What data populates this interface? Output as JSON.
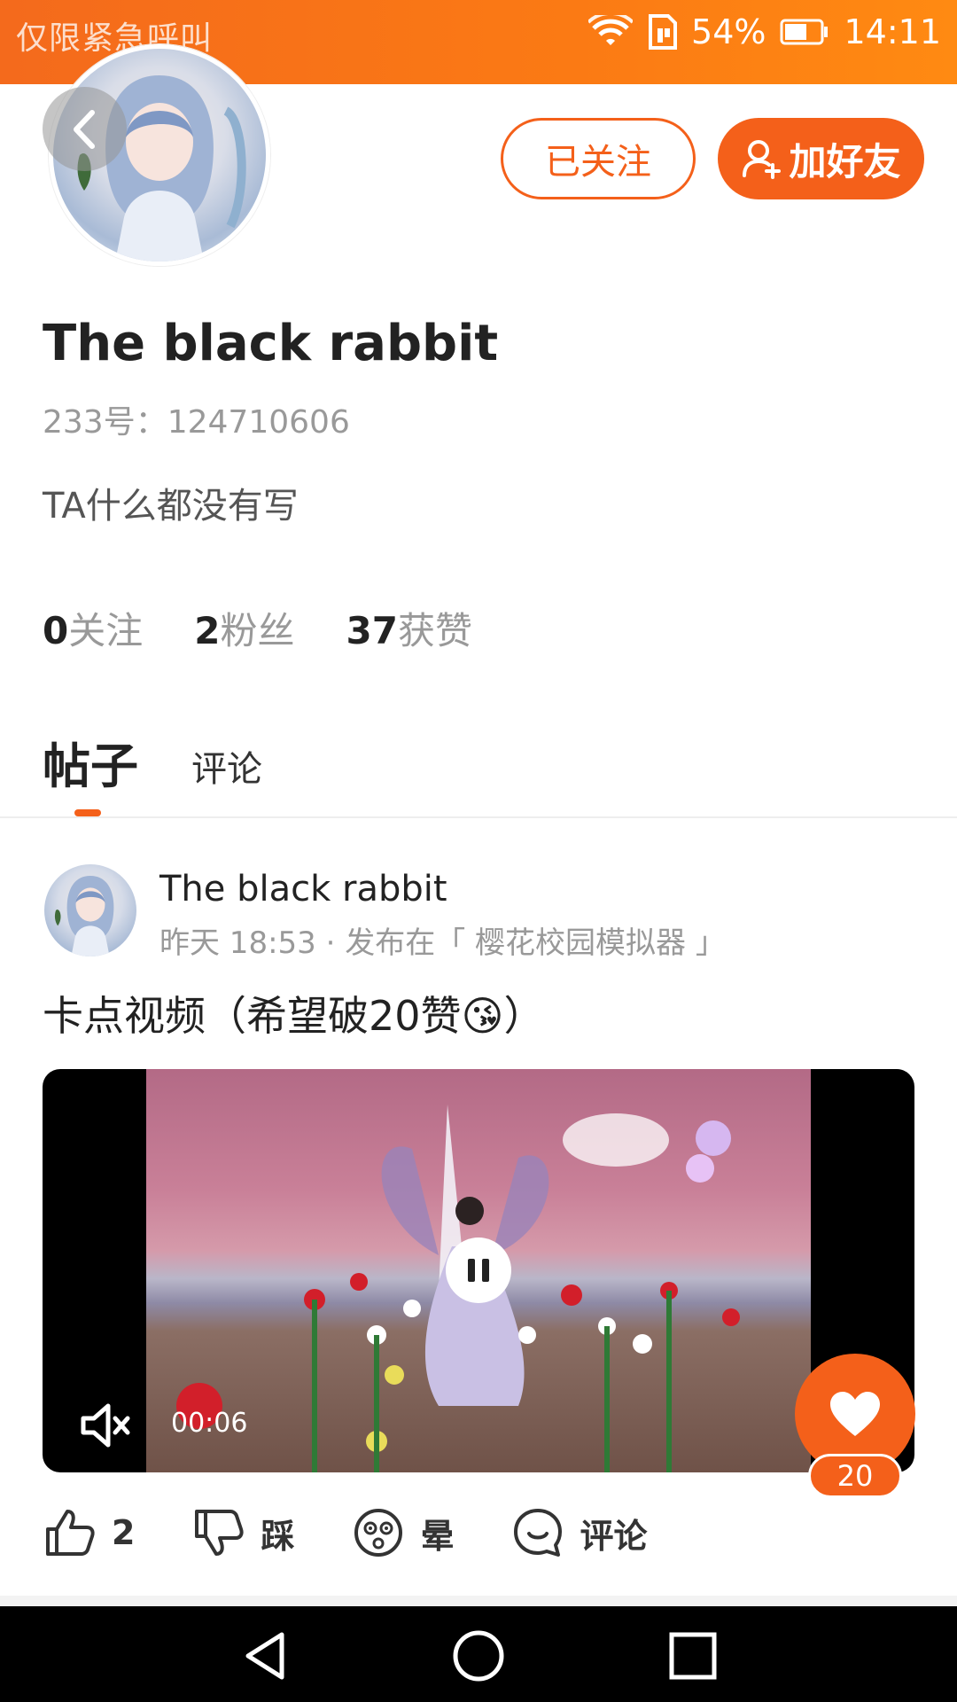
{
  "status_bar": {
    "carrier_text": "仅限紧急呼叫",
    "battery": "54%",
    "time": "14:11"
  },
  "profile": {
    "followed_label": "已关注",
    "add_friend_label": "加好友",
    "name": "The black rabbit",
    "id_label": "233号：",
    "id_value": "124710606",
    "bio": "TA什么都没有写",
    "stats": [
      {
        "num": "0",
        "label": "关注"
      },
      {
        "num": "2",
        "label": "粉丝"
      },
      {
        "num": "37",
        "label": "获赞"
      }
    ]
  },
  "tabs": {
    "posts": "帖子",
    "comments": "评论"
  },
  "post": {
    "author": "The black rabbit",
    "time": "昨天 18:53",
    "separator": " · ",
    "published_in": "发布在「 樱花校园模拟器 」",
    "title_text": "卡点视频（希望破20赞",
    "title_emoji": "😘",
    "title_end": "）",
    "video_time": "00:06",
    "like_count": "20"
  },
  "actions": {
    "like_count": "2",
    "dislike_label": "踩",
    "dizzy_label": "晕",
    "comment_label": "评论"
  },
  "colors": {
    "accent": "#f4601a",
    "status_bar": "#fb7a14"
  }
}
